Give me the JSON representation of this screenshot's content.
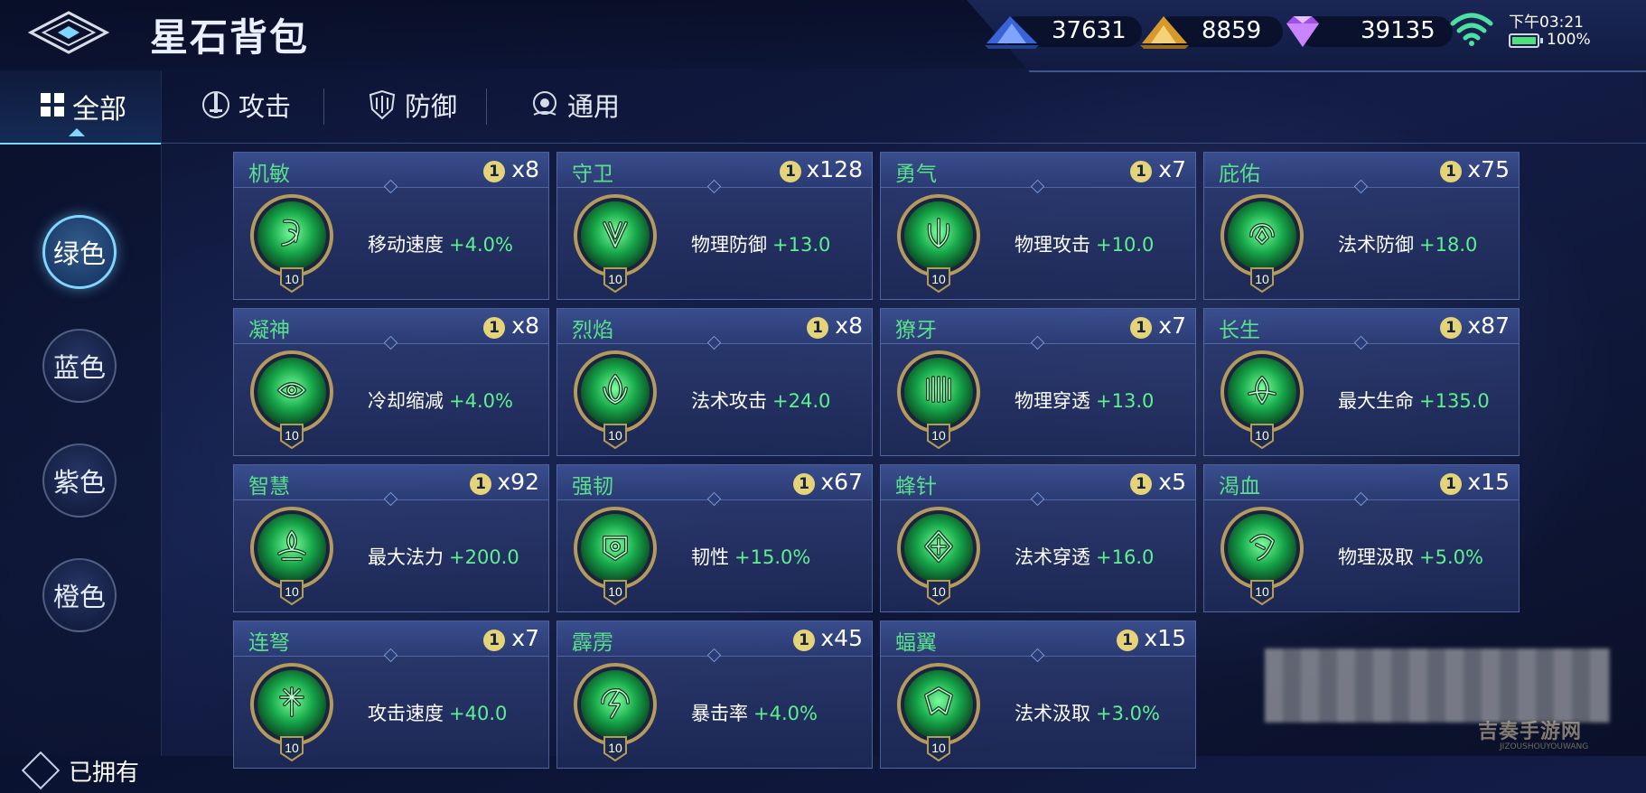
{
  "header": {
    "title": "星石背包"
  },
  "currencies": [
    {
      "name": "blue-crystal",
      "value": "37631",
      "color": "#4f7ff0"
    },
    {
      "name": "gold-crystal",
      "value": "8859",
      "color": "#e8b84a"
    },
    {
      "name": "purple-gem",
      "value": "39135",
      "color": "#b55cf0"
    }
  ],
  "status": {
    "time": "下午03:21",
    "battery": "100%"
  },
  "sidebar": {
    "all_label": "全部",
    "filters": [
      "绿色",
      "蓝色",
      "紫色",
      "橙色"
    ],
    "owned_label": "已拥有"
  },
  "tabs": [
    "攻击",
    "防御",
    "通用"
  ],
  "cards": [
    {
      "name": "机敏",
      "level": "1",
      "count": "x8",
      "stat": "移动速度",
      "value": "+4.0%",
      "grade": "10"
    },
    {
      "name": "守卫",
      "level": "1",
      "count": "x128",
      "stat": "物理防御",
      "value": "+13.0",
      "grade": "10"
    },
    {
      "name": "勇气",
      "level": "1",
      "count": "x7",
      "stat": "物理攻击",
      "value": "+10.0",
      "grade": "10"
    },
    {
      "name": "庇佑",
      "level": "1",
      "count": "x75",
      "stat": "法术防御",
      "value": "+18.0",
      "grade": "10"
    },
    {
      "name": "凝神",
      "level": "1",
      "count": "x8",
      "stat": "冷却缩减",
      "value": "+4.0%",
      "grade": "10"
    },
    {
      "name": "烈焰",
      "level": "1",
      "count": "x8",
      "stat": "法术攻击",
      "value": "+24.0",
      "grade": "10"
    },
    {
      "name": "獠牙",
      "level": "1",
      "count": "x7",
      "stat": "物理穿透",
      "value": "+13.0",
      "grade": "10"
    },
    {
      "name": "长生",
      "level": "1",
      "count": "x87",
      "stat": "最大生命",
      "value": "+135.0",
      "grade": "10"
    },
    {
      "name": "智慧",
      "level": "1",
      "count": "x92",
      "stat": "最大法力",
      "value": "+200.0",
      "grade": "10"
    },
    {
      "name": "强韧",
      "level": "1",
      "count": "x67",
      "stat": "韧性",
      "value": "+15.0%",
      "grade": "10"
    },
    {
      "name": "蜂针",
      "level": "1",
      "count": "x5",
      "stat": "法术穿透",
      "value": "+16.0",
      "grade": "10"
    },
    {
      "name": "渴血",
      "level": "1",
      "count": "x15",
      "stat": "物理汲取",
      "value": "+5.0%",
      "grade": "10"
    },
    {
      "name": "连弩",
      "level": "1",
      "count": "x7",
      "stat": "攻击速度",
      "value": "+40.0",
      "grade": "10"
    },
    {
      "name": "霹雳",
      "level": "1",
      "count": "x45",
      "stat": "暴击率",
      "value": "+4.0%",
      "grade": "10"
    },
    {
      "name": "蝠翼",
      "level": "1",
      "count": "x15",
      "stat": "法术汲取",
      "value": "+3.0%",
      "grade": "10"
    }
  ],
  "watermark": {
    "text": "吉奏手游网",
    "sub": "JIZOUSHOUYOUWANG"
  }
}
